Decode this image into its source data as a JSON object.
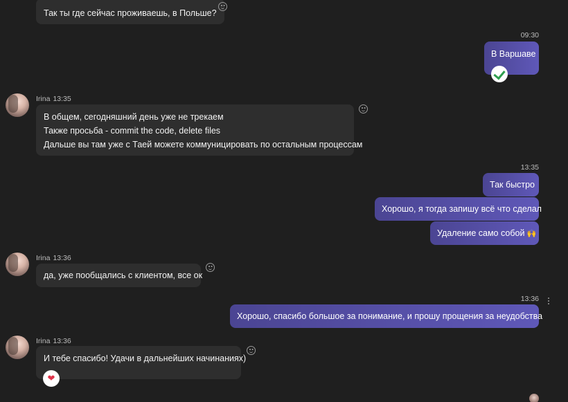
{
  "messages": {
    "m1": {
      "text": "Так ты где сейчас проживаешь, в Польше?"
    },
    "m2": {
      "time": "09:30",
      "text": "В Варшаве"
    },
    "m3": {
      "sender": "Irina",
      "time": "13:35",
      "lines": [
        "В общем, сегодняшний день уже не трекаем",
        "Также просьба - commit the code, delete files",
        "Дальше вы там уже с Таей можете коммуницировать по остальным процессам"
      ]
    },
    "m4": {
      "time": "13:35",
      "texts": [
        "Так быстро",
        "Хорошо, я тогда запишу всё что сделал",
        "Удаление само собой"
      ],
      "emoji": "🙌"
    },
    "m5": {
      "sender": "Irina",
      "time": "13:36",
      "text": "да, уже пообщались с клиентом, все ок"
    },
    "m6": {
      "time": "13:36",
      "text": "Хорошо, спасибо большое за понимание, и прошу прощения за неудобства"
    },
    "m7": {
      "sender": "Irina",
      "time": "13:36",
      "text": "И тебе спасибо! Удачи в дальнейших начинаниях)",
      "reaction": "❤"
    }
  },
  "icons": {
    "reaction": "smiley-reaction-icon",
    "check": "green-check-reaction-icon",
    "heart": "heart-reaction-icon",
    "more": "more-options-icon"
  },
  "colors": {
    "background": "#1f1f1f",
    "incoming_bubble": "#2e2e2e",
    "outgoing_bubble_start": "#4b4593",
    "outgoing_bubble_end": "#5f58b8",
    "check_green": "#2e9e4f",
    "heart_red": "#e0344b"
  }
}
